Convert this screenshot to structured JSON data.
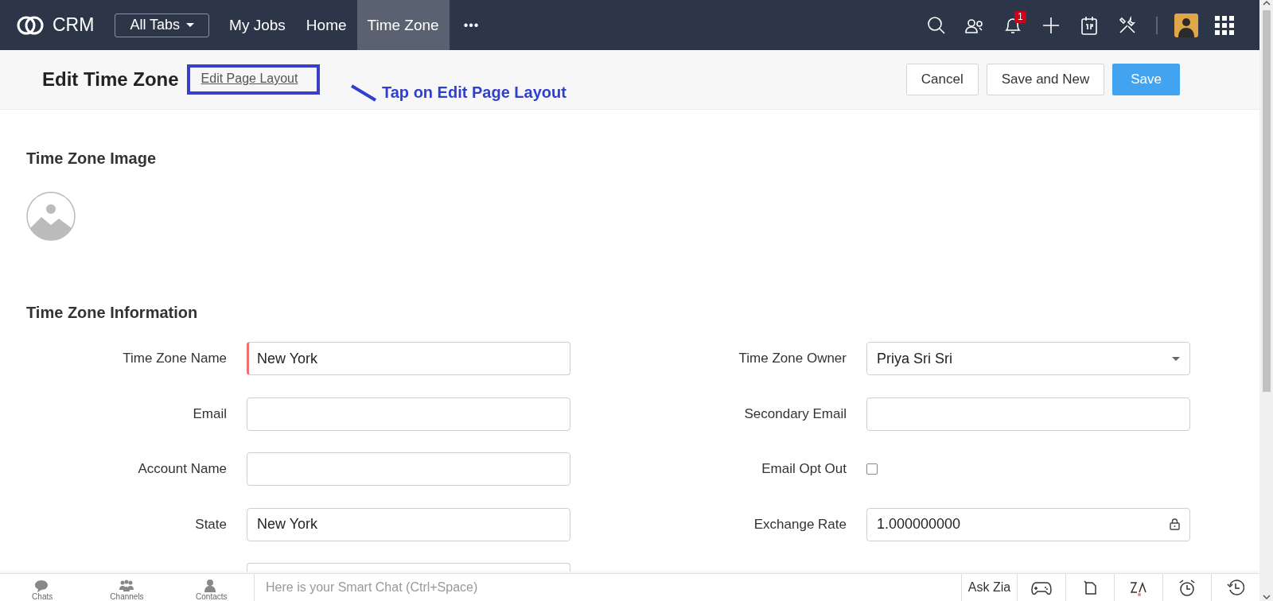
{
  "topbar": {
    "logo": "CRM",
    "all_tabs": "All Tabs",
    "tabs": [
      {
        "label": "My Jobs",
        "selected": false
      },
      {
        "label": "Home",
        "selected": false
      },
      {
        "label": "Time Zone",
        "selected": true
      }
    ],
    "more": "•••",
    "notification_count": "1"
  },
  "header": {
    "title": "Edit Time Zone",
    "link": "Edit Page Layout",
    "buttons": [
      {
        "label": "Cancel",
        "kind": "default"
      },
      {
        "label": "Save and New",
        "kind": "default"
      },
      {
        "label": "Save",
        "kind": "primary"
      }
    ]
  },
  "annotation": {
    "text": "Tap on Edit Page Layout"
  },
  "image_section": {
    "title": "Time Zone Image"
  },
  "info_section": {
    "title": "Time Zone Information",
    "rows": [
      {
        "left": {
          "kind": "text",
          "label": "Time Zone Name",
          "value": "New York",
          "required": true
        },
        "right": {
          "kind": "select",
          "label": "Time Zone Owner",
          "value": "Priya Sri Sri"
        }
      },
      {
        "left": {
          "kind": "text",
          "label": "Email",
          "required": false
        },
        "right": {
          "kind": "text",
          "label": "Secondary Email",
          "required": false
        }
      },
      {
        "left": {
          "kind": "text",
          "label": "Account Name",
          "required": false
        },
        "right": {
          "kind": "checkbox",
          "label": "Email Opt Out",
          "checked": false
        }
      },
      {
        "left": {
          "kind": "text",
          "label": "State",
          "value": "New York",
          "required": false
        },
        "right": {
          "kind": "locked",
          "label": "Exchange Rate",
          "value": "1.000000000"
        }
      },
      {
        "left": {
          "kind": "text",
          "required": false
        }
      }
    ]
  },
  "bottom_bar": {
    "items": [
      {
        "label": "Chats",
        "kind": "chats"
      },
      {
        "label": "Channels",
        "kind": "channels"
      },
      {
        "label": "Contacts",
        "kind": "contacts"
      }
    ],
    "chat_placeholder": "Here is your Smart Chat (Ctrl+Space)",
    "ask_zia": "Ask Zia"
  }
}
